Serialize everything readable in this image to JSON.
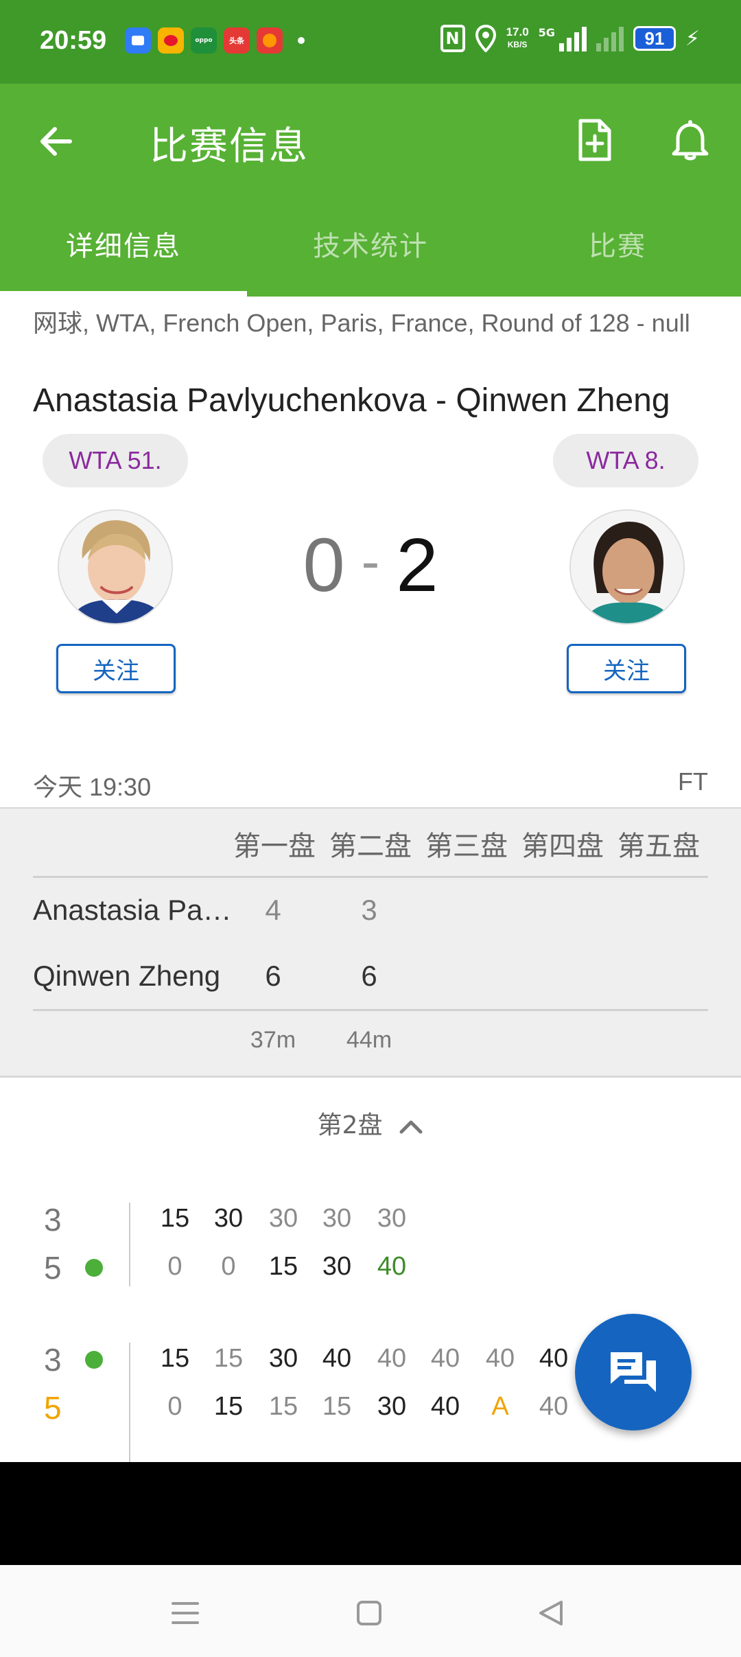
{
  "status_bar": {
    "time": "20:59",
    "net_speed_value": "17.0",
    "net_speed_unit": "KB/S",
    "network": "5G",
    "battery": "91"
  },
  "app_bar": {
    "title": "比赛信息"
  },
  "tabs": [
    {
      "label": "详细信息",
      "active": true
    },
    {
      "label": "技术统计",
      "active": false
    },
    {
      "label": "比赛",
      "active": false
    }
  ],
  "match": {
    "breadcrumb": "网球, WTA, French Open, Paris, France, Round of 128 - null",
    "title": "Anastasia Pavlyuchenkova - Qinwen Zheng",
    "home": {
      "rank": "WTA 51.",
      "follow": "关注",
      "score": "0"
    },
    "away": {
      "rank": "WTA 8.",
      "follow": "关注",
      "score": "2"
    },
    "score_sep": "-",
    "time": "今天 19:30",
    "status": "FT"
  },
  "sets": {
    "headers": [
      "第一盘",
      "第二盘",
      "第三盘",
      "第四盘",
      "第五盘"
    ],
    "rows": [
      {
        "name": "Anastasia Pa…",
        "values": [
          "4",
          "3"
        ]
      },
      {
        "name": "Qinwen Zheng",
        "values": [
          "6",
          "6"
        ]
      }
    ],
    "durations": [
      "37m",
      "44m"
    ]
  },
  "set_selector": {
    "label": "第2盘"
  },
  "games": [
    {
      "top": {
        "games": "3",
        "points": [
          "15",
          "30",
          "30",
          "30",
          "30"
        ]
      },
      "bottom": {
        "games": "5",
        "points": [
          "0",
          "0",
          "15",
          "30",
          "40"
        ]
      },
      "server": "bottom"
    },
    {
      "top": {
        "games": "3",
        "points": [
          "15",
          "15",
          "30",
          "40",
          "40",
          "40",
          "40",
          "40"
        ]
      },
      "bottom": {
        "games": "5",
        "points": [
          "0",
          "15",
          "15",
          "15",
          "30",
          "40",
          "A",
          "40"
        ]
      },
      "server": "top"
    }
  ],
  "colors": {
    "status_bar": "#3f9a2a",
    "app_bar": "#57b134",
    "accent_blue": "#1565c0",
    "rank_text": "#8a2a9e",
    "serve_dot": "#4caf3a",
    "advantage": "#f0a400"
  }
}
